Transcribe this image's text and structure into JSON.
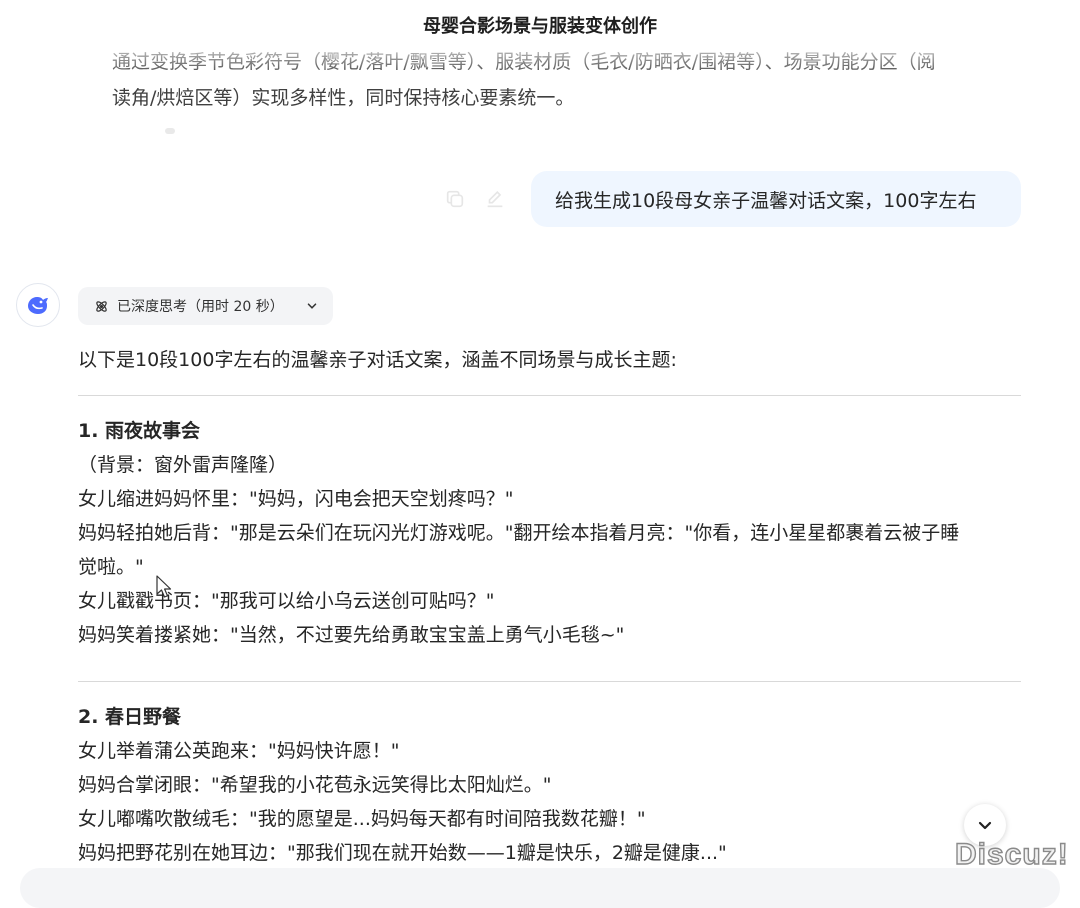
{
  "conversation": {
    "title": "母婴合影场景与服装变体创作",
    "previous_answer_tail": {
      "line1": "通过变换季节色彩符号（樱花/落叶/飘雪等）、服装材质（毛衣/防晒衣/围裙等）、场景功能分区（阅",
      "line2": "读角/烘焙区等）实现多样性，同时保持核心要素统一。"
    }
  },
  "user_message": {
    "text": "给我生成10段母女亲子温馨对话文案，100字左右",
    "tools": [
      "copy-icon",
      "edit-icon"
    ]
  },
  "assistant": {
    "avatar_icon": "whale-logo-icon",
    "thinking_label": "已深度思考（用时 20 秒）",
    "intro": "以下是10段100字左右的温馨亲子对话文案，涵盖不同场景与成长主题:",
    "sections": [
      {
        "heading": "1. 雨夜故事会",
        "lines": [
          "（背景：窗外雷声隆隆）",
          "女儿缩进妈妈怀里：\"妈妈，闪电会把天空划疼吗？\"",
          "妈妈轻拍她后背：\"那是云朵们在玩闪光灯游戏呢。\"翻开绘本指着月亮：\"你看，连小星星都裹着云被子睡",
          "觉啦。\"",
          "女儿戳戳书页：\"那我可以给小乌云送创可贴吗？\"",
          "妈妈笑着搂紧她：\"当然，不过要先给勇敢宝宝盖上勇气小毛毯~\""
        ]
      },
      {
        "heading": "2. 春日野餐",
        "lines": [
          "女儿举着蒲公英跑来：\"妈妈快许愿！\"",
          "妈妈合掌闭眼：\"希望我的小花苞永远笑得比太阳灿烂。\"",
          "女儿嘟嘴吹散绒毛：\"我的愿望是...妈妈每天都有时间陪我数花瓣！\"",
          "妈妈把野花别在她耳边：\"那我们现在就开始数——1瓣是快乐，2瓣是健康...\""
        ]
      }
    ]
  },
  "watermark": "Discuz!",
  "colors": {
    "user_bubble": "#eff6ff",
    "think_pill": "#f3f4f6",
    "avatar_blue": "#4d6bfe"
  }
}
